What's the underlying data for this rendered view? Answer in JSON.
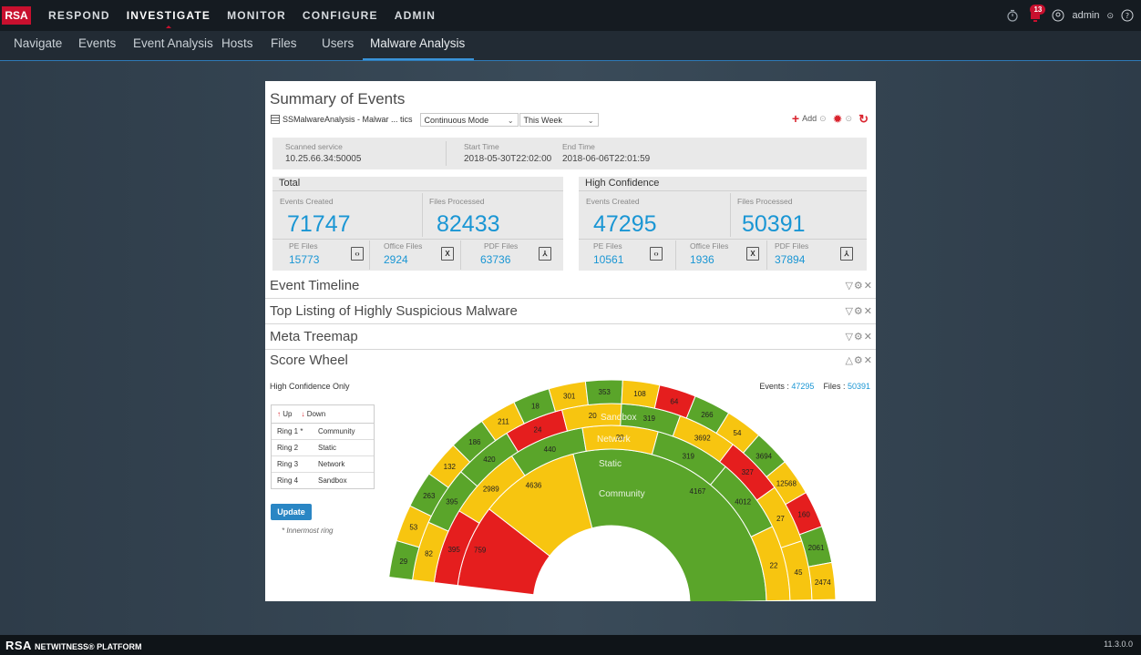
{
  "app": {
    "logo": "RSA",
    "main_nav": [
      "RESPOND",
      "INVESTIGATE",
      "MONITOR",
      "CONFIGURE",
      "ADMIN"
    ],
    "active_main": "INVESTIGATE",
    "notifications_count": "13",
    "user": "admin",
    "sub_nav": [
      "Navigate",
      "Events",
      "Event Analysis",
      "Hosts",
      "Files",
      "Users",
      "Malware Analysis"
    ],
    "active_sub": "Malware Analysis",
    "footer_brand": "RSA",
    "footer_product": "NETWITNESS® PLATFORM",
    "version": "11.3.0.0"
  },
  "dashboard": {
    "title": "Summary of Events",
    "source": "SSMalwareAnalysis - Malwar ... tics",
    "mode": "Continuous Mode",
    "range": "This Week",
    "add_label": "Add"
  },
  "info": {
    "scanned_label": "Scanned service",
    "scanned_value": "10.25.66.34:50005",
    "start_label": "Start Time",
    "start_value": "2018-05-30T22:02:00",
    "end_label": "End Time",
    "end_value": "2018-06-06T22:01:59"
  },
  "total": {
    "title": "Total",
    "events_label": "Events Created",
    "events": "71747",
    "files_label": "Files Processed",
    "files": "82433",
    "pe_label": "PE Files",
    "pe": "15773",
    "office_label": "Office Files",
    "office": "2924",
    "pdf_label": "PDF Files",
    "pdf": "63736"
  },
  "high": {
    "title": "High Confidence",
    "events_label": "Events Created",
    "events": "47295",
    "files_label": "Files Processed",
    "files": "50391",
    "pe_label": "PE Files",
    "pe": "10561",
    "office_label": "Office Files",
    "office": "1936",
    "pdf_label": "PDF Files",
    "pdf": "37894"
  },
  "sections": [
    "Event Timeline",
    "Top Listing of Highly Suspicious Malware",
    "Meta Treemap"
  ],
  "score_wheel": {
    "title": "Score Wheel",
    "filter": "High Confidence Only",
    "events_label": "Events :",
    "events": "47295",
    "files_label": "Files :",
    "files": "50391",
    "up": "Up",
    "down": "Down",
    "rings": [
      {
        "ring": "Ring 1 *",
        "name": "Community"
      },
      {
        "ring": "Ring 2",
        "name": "Static"
      },
      {
        "ring": "Ring 3",
        "name": "Network"
      },
      {
        "ring": "Ring 4",
        "name": "Sandbox"
      }
    ],
    "update": "Update",
    "note": "* Innermost ring",
    "ring_labels": [
      "Community",
      "Static",
      "Network",
      "Sandbox"
    ],
    "colors": {
      "green": "#5aa52a",
      "yellow": "#f7c510",
      "red": "#e51e1e"
    },
    "segments": [
      {
        "ring": 0,
        "value": "4167",
        "color": "green"
      },
      {
        "ring": 0,
        "value": "4636",
        "color": "yellow"
      },
      {
        "ring": 0,
        "value": "759",
        "color": "red"
      },
      {
        "ring": 1,
        "value": "319",
        "color": "green"
      },
      {
        "ring": 1,
        "value": "2989",
        "color": "yellow"
      },
      {
        "ring": 1,
        "value": "395",
        "color": "red"
      },
      {
        "ring": 1,
        "value": "440",
        "color": "green"
      },
      {
        "ring": 1,
        "value": "20",
        "color": "yellow"
      },
      {
        "ring": 1,
        "value": "319",
        "color": "yellow"
      },
      {
        "ring": 1,
        "value": "4012",
        "color": "green"
      },
      {
        "ring": 1,
        "value": "22",
        "color": "yellow"
      },
      {
        "ring": 2,
        "value": "319",
        "color": "green"
      },
      {
        "ring": 2,
        "value": "3692",
        "color": "yellow"
      },
      {
        "ring": 2,
        "value": "20",
        "color": "yellow"
      },
      {
        "ring": 2,
        "value": "24",
        "color": "red"
      },
      {
        "ring": 2,
        "value": "420",
        "color": "green"
      },
      {
        "ring": 2,
        "value": "395",
        "color": "green"
      },
      {
        "ring": 2,
        "value": "82",
        "color": "yellow"
      },
      {
        "ring": 2,
        "value": "327",
        "color": "red"
      },
      {
        "ring": 2,
        "value": "27",
        "color": "yellow"
      },
      {
        "ring": 2,
        "value": "45",
        "color": "yellow"
      },
      {
        "ring": 3,
        "value": "18",
        "color": "green"
      },
      {
        "ring": 3,
        "value": "301",
        "color": "yellow"
      },
      {
        "ring": 3,
        "value": "353",
        "color": "green"
      },
      {
        "ring": 3,
        "value": "108",
        "color": "yellow"
      },
      {
        "ring": 3,
        "value": "64",
        "color": "red"
      },
      {
        "ring": 3,
        "value": "266",
        "color": "green"
      },
      {
        "ring": 3,
        "value": "54",
        "color": "yellow"
      },
      {
        "ring": 3,
        "value": "3694",
        "color": "green"
      },
      {
        "ring": 3,
        "value": "12568",
        "color": "yellow"
      },
      {
        "ring": 3,
        "value": "160",
        "color": "red"
      },
      {
        "ring": 3,
        "value": "2061",
        "color": "green"
      },
      {
        "ring": 3,
        "value": "2474",
        "color": "yellow"
      },
      {
        "ring": 3,
        "value": "211",
        "color": "yellow"
      },
      {
        "ring": 3,
        "value": "186",
        "color": "green"
      },
      {
        "ring": 3,
        "value": "132",
        "color": "yellow"
      },
      {
        "ring": 3,
        "value": "263",
        "color": "green"
      },
      {
        "ring": 3,
        "value": "53",
        "color": "yellow"
      },
      {
        "ring": 3,
        "value": "29",
        "color": "green"
      }
    ]
  }
}
